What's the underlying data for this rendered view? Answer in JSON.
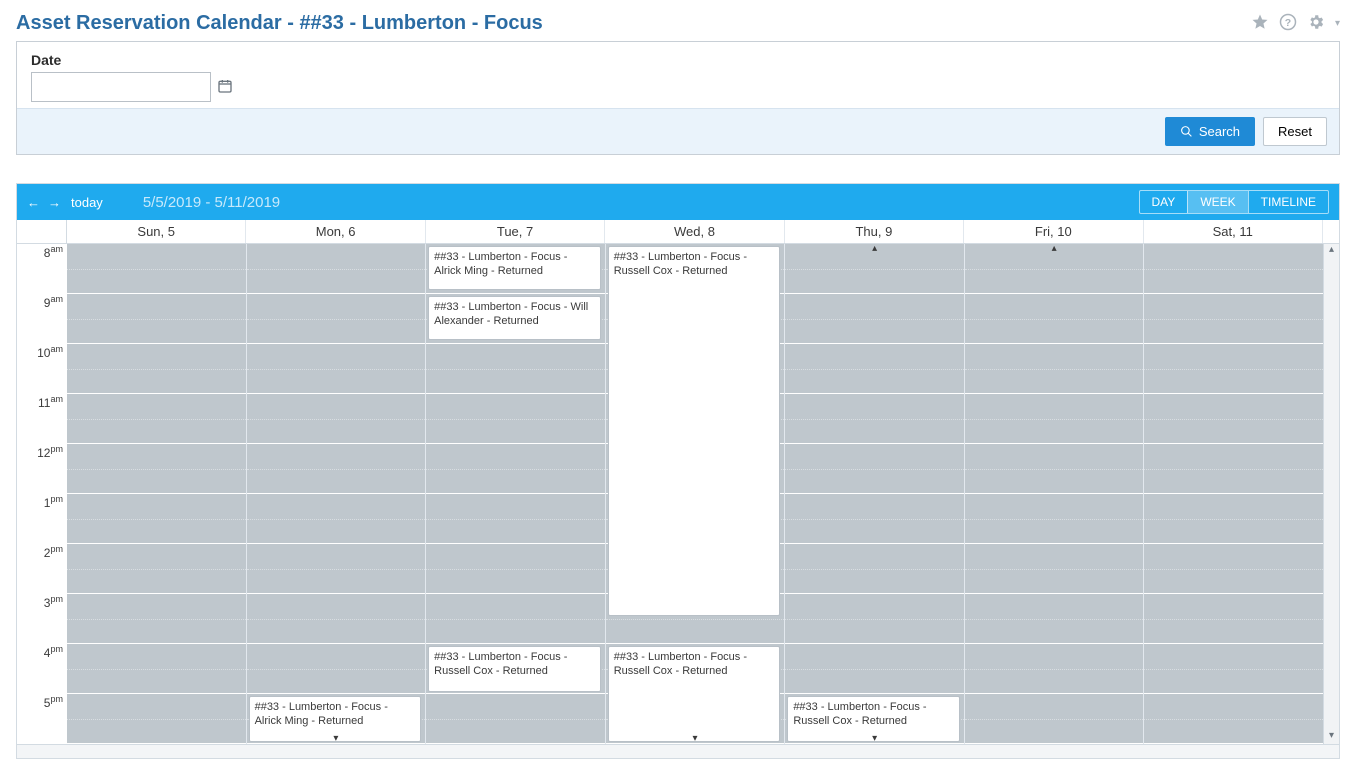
{
  "header": {
    "title": "Asset Reservation Calendar - ##33 - Lumberton - Focus"
  },
  "filter": {
    "date_label": "Date",
    "date_value": "",
    "search_label": "Search",
    "reset_label": "Reset"
  },
  "toolbar": {
    "today_label": "today",
    "date_range": "5/5/2019 - 5/11/2019",
    "views": {
      "day": "DAY",
      "week": "WEEK",
      "timeline": "TIMELINE"
    },
    "active_view": "week"
  },
  "days": [
    {
      "label": "Sun, 5"
    },
    {
      "label": "Mon, 6"
    },
    {
      "label": "Tue, 7"
    },
    {
      "label": "Wed, 8"
    },
    {
      "label": "Thu, 9"
    },
    {
      "label": "Fri, 10"
    },
    {
      "label": "Sat, 11"
    }
  ],
  "hours": [
    {
      "num": "8",
      "ampm": "am"
    },
    {
      "num": "9",
      "ampm": "am"
    },
    {
      "num": "10",
      "ampm": "am"
    },
    {
      "num": "11",
      "ampm": "am"
    },
    {
      "num": "12",
      "ampm": "pm"
    },
    {
      "num": "1",
      "ampm": "pm"
    },
    {
      "num": "2",
      "ampm": "pm"
    },
    {
      "num": "3",
      "ampm": "pm"
    },
    {
      "num": "4",
      "ampm": "pm"
    },
    {
      "num": "5",
      "ampm": "pm"
    }
  ],
  "events": {
    "mon_5pm": "##33 - Lumberton - Focus - Alrick Ming - Returned",
    "tue_8am": "##33 - Lumberton - Focus - Alrick Ming - Returned",
    "tue_9am": "##33 - Lumberton - Focus - Will Alexander - Returned",
    "tue_4pm": "##33 - Lumberton - Focus - Russell Cox - Returned",
    "wed_8am": "##33 - Lumberton - Focus - Russell Cox - Returned",
    "wed_4pm": "##33 - Lumberton - Focus - Russell Cox - Returned",
    "thu_5pm": "##33 - Lumberton - Focus - Russell Cox - Returned"
  }
}
